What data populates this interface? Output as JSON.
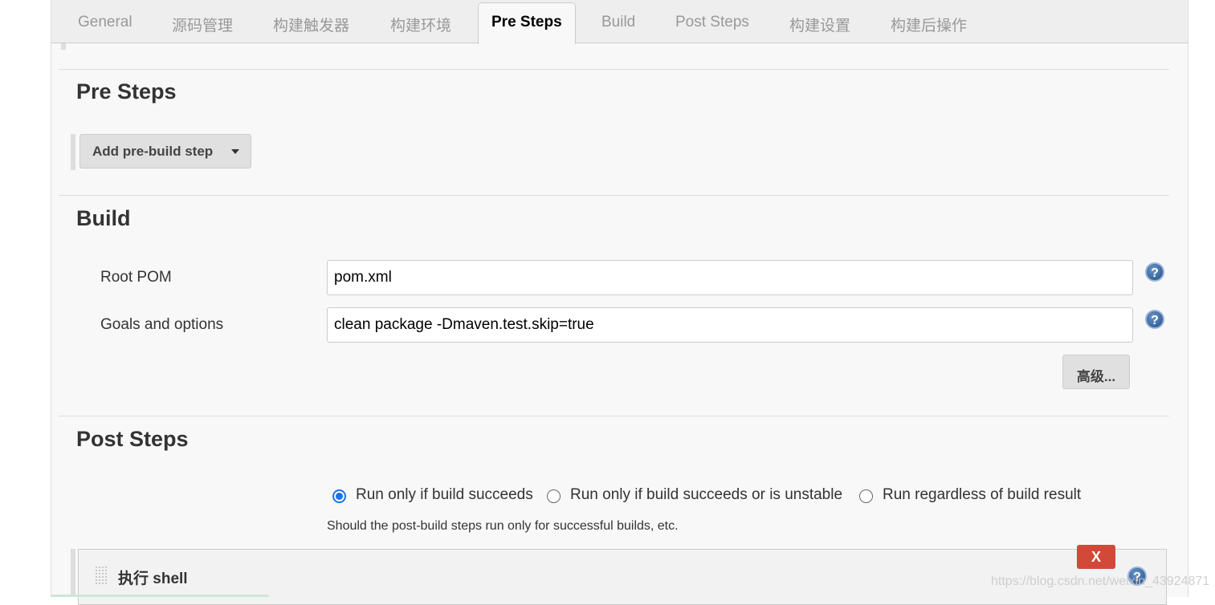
{
  "tabs": [
    "General",
    "源码管理",
    "构建触发器",
    "构建环境",
    "Pre Steps",
    "Build",
    "Post Steps",
    "构建设置",
    "构建后操作"
  ],
  "active_tab": "Pre Steps",
  "pre_steps": {
    "title": "Pre Steps",
    "add_button": "Add pre-build step"
  },
  "build": {
    "title": "Build",
    "root_pom_label": "Root POM",
    "root_pom_value": "pom.xml",
    "goals_label": "Goals and options",
    "goals_value": "clean package -Dmaven.test.skip=true",
    "advanced_button": "高级..."
  },
  "post_steps": {
    "title": "Post Steps",
    "options": [
      "Run only if build succeeds",
      "Run only if build succeeds or is unstable",
      "Run regardless of build result"
    ],
    "selected": 0,
    "hint": "Should the post-build steps run only for successful builds, etc.",
    "step_title": "执行 shell",
    "delete_button": "X"
  },
  "watermark": "https://blog.csdn.net/weixin_43924871",
  "colors": {
    "delete": "#d24939",
    "radio": "#1a73e8"
  }
}
